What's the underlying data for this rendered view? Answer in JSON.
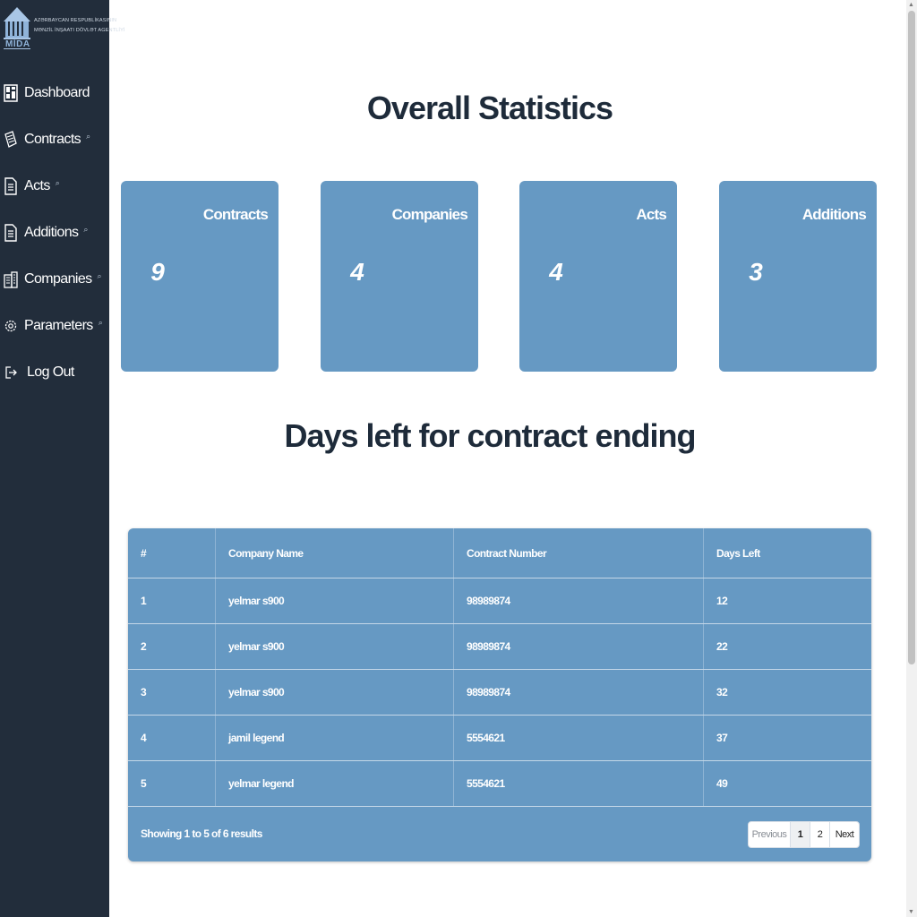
{
  "logo": {
    "line1": "AZƏRBAYCAN RESPUBLİKASININ",
    "line2": "MƏNZİL İNŞAATI DÖVLƏT AGENTLİYİ",
    "abbr": "MİDA"
  },
  "sidebar": {
    "items": [
      {
        "label": "Dashboard",
        "icon": "dashboard-icon",
        "search": false
      },
      {
        "label": "Contracts",
        "icon": "contracts-icon",
        "search": true
      },
      {
        "label": "Acts",
        "icon": "document-icon",
        "search": true
      },
      {
        "label": "Additions",
        "icon": "document-icon",
        "search": true
      },
      {
        "label": "Companies",
        "icon": "building-icon",
        "search": true
      },
      {
        "label": "Parameters",
        "icon": "gear-icon",
        "search": true
      },
      {
        "label": "Log Out",
        "icon": "logout-icon",
        "search": false
      }
    ],
    "search_glyph": "⌕"
  },
  "main": {
    "title": "Overall Statistics",
    "cards": [
      {
        "title": "Contracts",
        "value": "9"
      },
      {
        "title": "Companies",
        "value": "4"
      },
      {
        "title": "Acts",
        "value": "4"
      },
      {
        "title": "Additions",
        "value": "3"
      }
    ],
    "subtitle": "Days left for contract ending"
  },
  "table": {
    "columns": [
      "#",
      "Company Name",
      "Contract Number",
      "Days Left"
    ],
    "rows": [
      [
        "1",
        "yelmar s900",
        "98989874",
        "12"
      ],
      [
        "2",
        "yelmar s900",
        "98989874",
        "22"
      ],
      [
        "3",
        "yelmar s900",
        "98989874",
        "32"
      ],
      [
        "4",
        "jamil legend",
        "5554621",
        "37"
      ],
      [
        "5",
        "yelmar legend",
        "5554621",
        "49"
      ]
    ],
    "showing": "Showing 1 to 5 of 6 results",
    "pagination": {
      "previous": "Previous",
      "page1": "1",
      "page2": "2",
      "next": "Next"
    }
  },
  "colors": {
    "sidebar_bg": "#222d3b",
    "card_bg": "#6699c3",
    "heading": "#1e2b3a"
  }
}
